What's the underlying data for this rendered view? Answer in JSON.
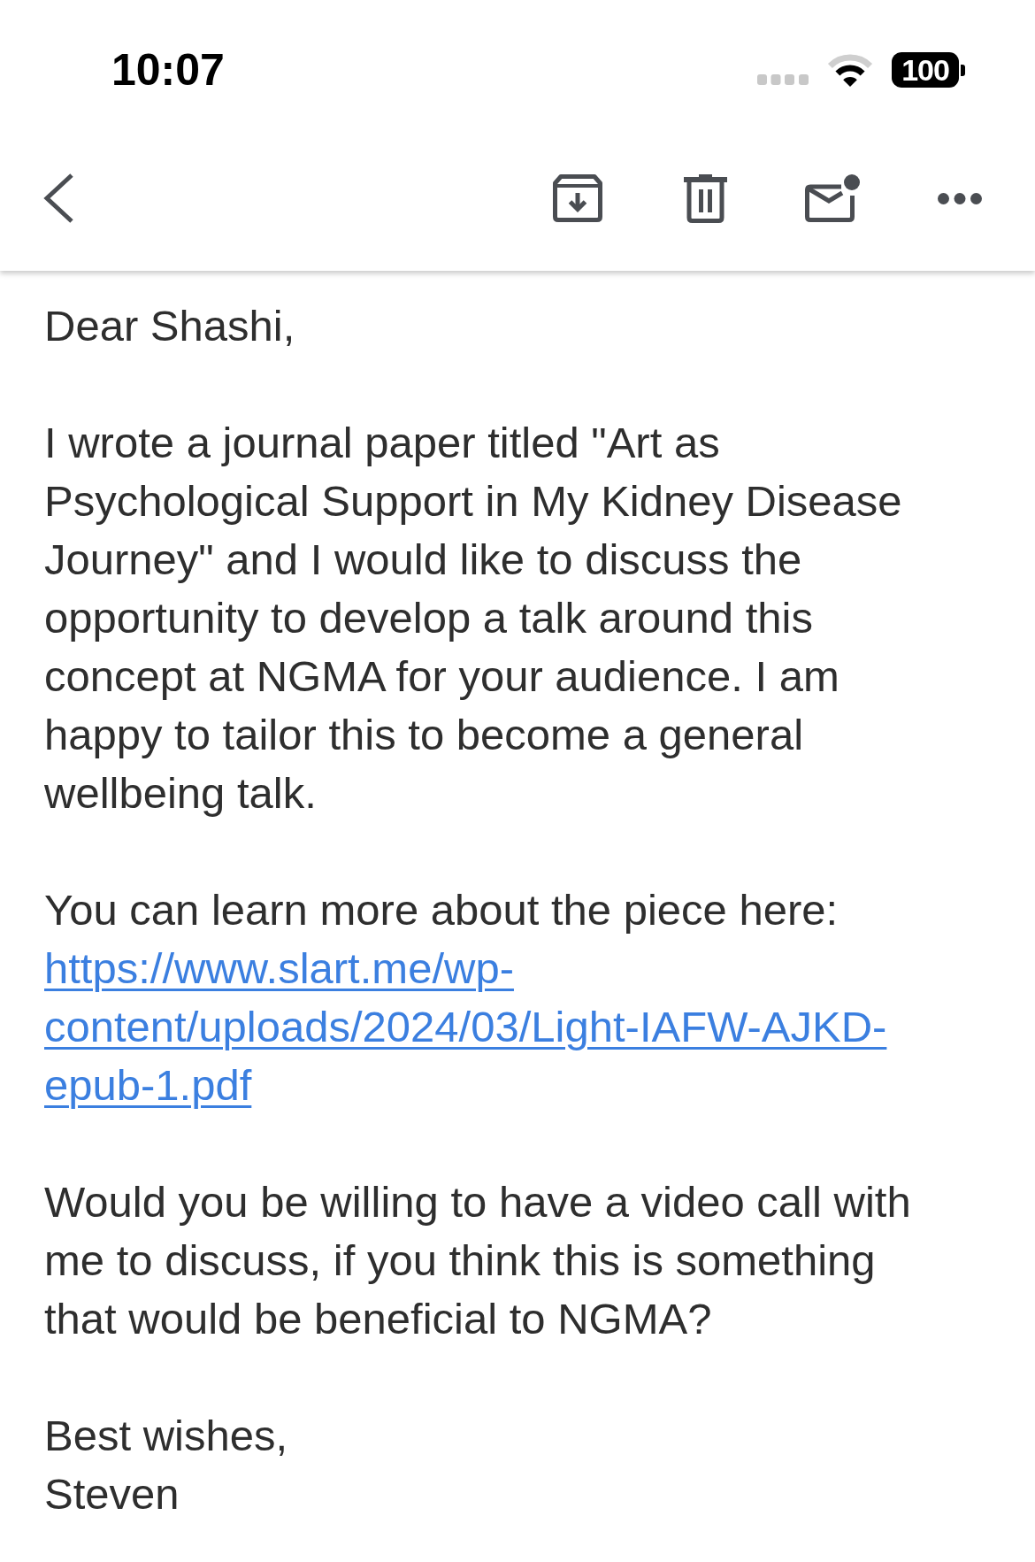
{
  "status_bar": {
    "time": "10:07",
    "battery": "100"
  },
  "message": {
    "paragraphs": [
      {
        "parts": [
          {
            "kind": "text",
            "text": "Dear Shashi,"
          }
        ]
      },
      {
        "parts": [
          {
            "kind": "text",
            "text": "I wrote a journal paper titled \"Art as Psychological Support in My Kidney Disease Journey\" and I would like to discuss the opportunity to develop a talk around this concept at NGMA for your audience. I am happy to tailor this to become a general wellbeing talk."
          }
        ]
      },
      {
        "parts": [
          {
            "kind": "text",
            "text": "You can learn more about the piece here:"
          },
          {
            "kind": "link",
            "text": "https://www.slart.me/wp-content/uploads/2024/03/Light-IAFW-AJKD-epub-1.pdf"
          }
        ]
      },
      {
        "parts": [
          {
            "kind": "text",
            "text": "Would you be willing to have a video call with me to discuss, if you think this is something that would be beneficial to NGMA?"
          }
        ]
      },
      {
        "parts": [
          {
            "kind": "text",
            "text": "Best wishes,"
          },
          {
            "kind": "text",
            "text": "Steven"
          }
        ]
      }
    ]
  }
}
